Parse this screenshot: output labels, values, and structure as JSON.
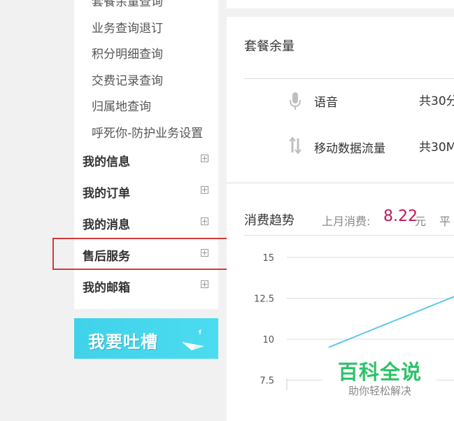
{
  "sidebar": {
    "sub_items": [
      "套餐余量查询",
      "业务查询退订",
      "积分明细查询",
      "交费记录查询",
      "归属地查询",
      "呼死你-防护业务设置"
    ],
    "sections": [
      "我的信息",
      "我的订单",
      "我的消息",
      "售后服务",
      "我的邮箱"
    ]
  },
  "feedback": {
    "label": "我要吐槽"
  },
  "package": {
    "title": "套餐余量",
    "rows": [
      {
        "icon": "microphone-icon",
        "label": "语音",
        "value": "共30分"
      },
      {
        "icon": "data-transfer-icon",
        "label": "移动数据流量",
        "value": "共30M"
      }
    ]
  },
  "trend": {
    "title": "消费趋势",
    "last_month_label": "上月消费:",
    "last_month_amount": "8.22",
    "unit": "元",
    "avg_label": "平"
  },
  "chart_data": {
    "type": "line",
    "y_ticks": [
      "15",
      "12.5",
      "10",
      "7.5"
    ],
    "ylim": [
      7.5,
      15
    ],
    "series": [
      {
        "x": [
          0.25,
          1.0
        ],
        "values": [
          9.5,
          12.6
        ]
      }
    ],
    "line_color": "#5bc8e8"
  },
  "watermark": {
    "title": "百科全说",
    "subtitle": "助你轻松解决"
  },
  "colors": {
    "highlight": "#d33a3a",
    "banner": "#3fd2ea",
    "amount": "#c2185b",
    "watermark": "#2ec26a"
  }
}
